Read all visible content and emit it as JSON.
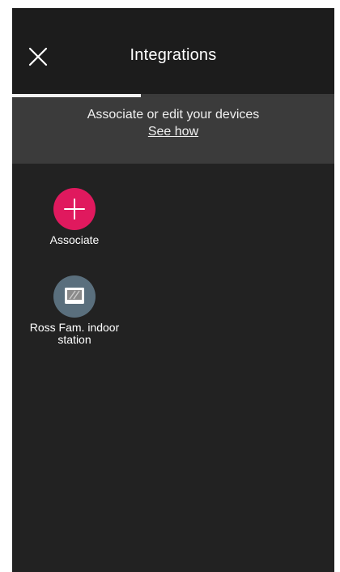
{
  "header": {
    "title": "Integrations",
    "close_icon": "close-icon"
  },
  "tabs": {
    "active_progress": 0.4
  },
  "banner": {
    "text": "Associate or edit your devices",
    "link": "See how"
  },
  "items": [
    {
      "label": "Associate",
      "icon": "plus-icon",
      "color": "#e0195e"
    },
    {
      "label_line1": "Ross Fam. indoor",
      "label_line2": "station",
      "icon": "indoor-station-icon",
      "color": "#5a6f7d"
    }
  ],
  "colors": {
    "background": "#222222",
    "banner": "#3b3b3b",
    "accent": "#e0195e"
  }
}
